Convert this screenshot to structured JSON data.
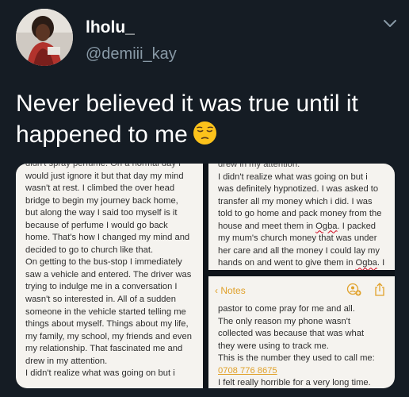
{
  "author": {
    "display_name": "lholu_",
    "handle": "@demiii_kay"
  },
  "tweet": {
    "text": "Never believed it was true until it happened to me",
    "emoji": "pensive-face"
  },
  "notes": {
    "left": [
      "didn't spray perfume. On a normal day I",
      "would just ignore it but that day my mind",
      "wasn't at rest. I climbed the over head",
      "bridge to begin my journey back home,",
      "but along the way I said too myself is it",
      "because of perfume I would go back",
      "home. That's how I changed my mind and",
      "decided to go to church like that.",
      "On getting to the bus-stop I immediately",
      "saw a vehicle and entered. The driver was",
      "trying to indulge me in a conversation I",
      "wasn't so interested in. All of a sudden",
      "someone in the vehicle started telling me",
      "things about myself. Things about my life,",
      "my family, my school, my friends and even",
      "my relationship. That fascinated me and",
      "drew in my attention.",
      "I didn't realize what was going on but i"
    ],
    "top_right": [
      "drew in my attention.",
      "I didn't realize what was going on but i",
      "was definitely hypnotized. I was asked to",
      "transfer all my money which i did. I was",
      "told to go home and pack money from the",
      "house and meet them in Ogba. I packed",
      "my mum's church money that was under",
      "her care and all the money I could lay my",
      "hands on and went to give them in Ogba. I"
    ],
    "bottom_right": {
      "back_label": "Notes",
      "lines": [
        "pastor to come pray for me and all.",
        "The only reason my phone wasn't",
        "collected was because that was what",
        "they were using to track me.",
        "This is the number they used to call me:"
      ],
      "phone_number": "0708 776 8675",
      "last_line": "I felt really horrible for a very long time."
    }
  },
  "colors": {
    "background": "#151c24",
    "handle": "#8899a6",
    "note_paper": "#f5f3ef",
    "notes_accent": "#e0a12a"
  }
}
